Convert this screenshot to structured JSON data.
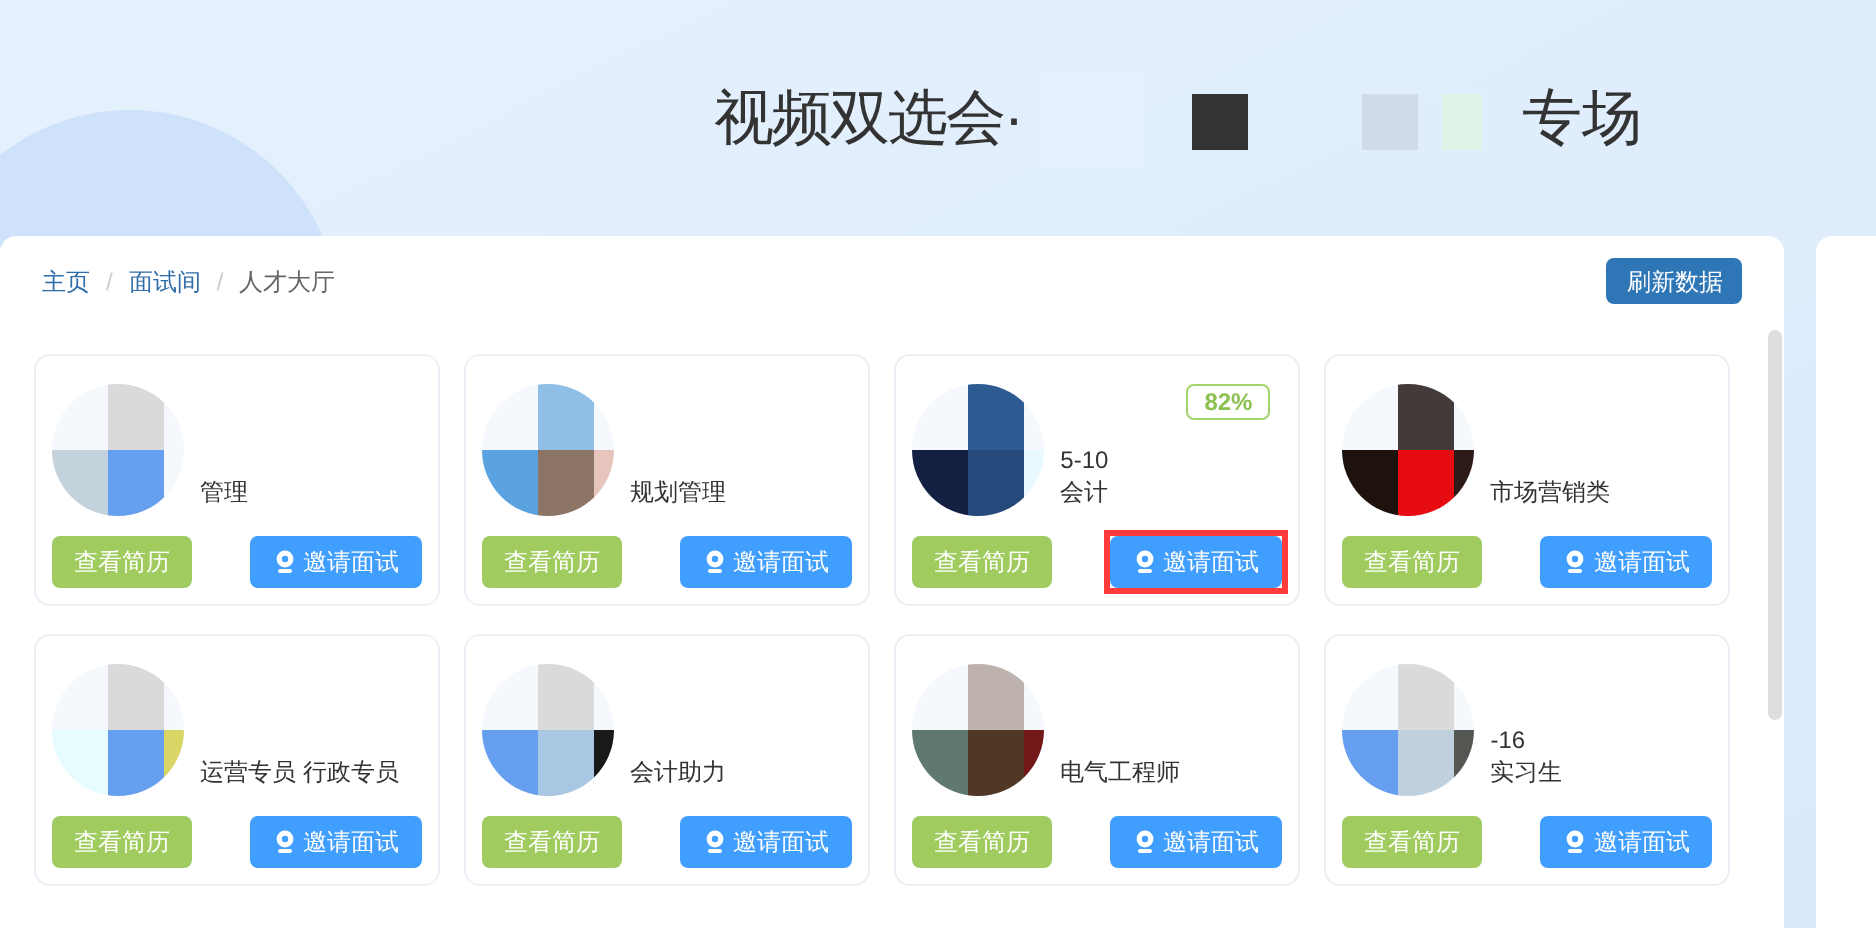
{
  "header": {
    "title_start": "视频双选会·",
    "title_end": "专场"
  },
  "breadcrumb": [
    {
      "label": "主页",
      "link": true
    },
    {
      "separator": "/"
    },
    {
      "label": "面试间",
      "link": true
    },
    {
      "separator": "/"
    },
    {
      "label": "人才大厅",
      "link": false
    }
  ],
  "refresh_button": "刷新数据",
  "cards": [
    {
      "job": "管理",
      "highlighted": false,
      "view_button": "查看简历",
      "invite_button": "邀请面试"
    },
    {
      "job": "规划管理",
      "highlighted": false,
      "view_button": "查看简历",
      "invite_button": "邀请面试"
    },
    {
      "info": "5-10",
      "job": "会计",
      "match": "82%",
      "highlighted": true,
      "view_button": "查看简历",
      "invite_button": "邀请面试"
    },
    {
      "job": "市场营销类",
      "highlighted": false,
      "view_button": "查看简历",
      "invite_button": "邀请面试"
    },
    {
      "job": "运营专员 行政专员",
      "highlighted": false,
      "view_button": "查看简历",
      "invite_button": "邀请面试"
    },
    {
      "job": "会计助力",
      "highlighted": false,
      "view_button": "查看简历",
      "invite_button": "邀请面试"
    },
    {
      "job": "电气工程师",
      "highlighted": false,
      "view_button": "查看简历",
      "invite_button": "邀请面试"
    },
    {
      "info": "-16",
      "job": "实习生",
      "highlighted": false,
      "view_button": "查看简历",
      "invite_button": "邀请面试"
    }
  ]
}
